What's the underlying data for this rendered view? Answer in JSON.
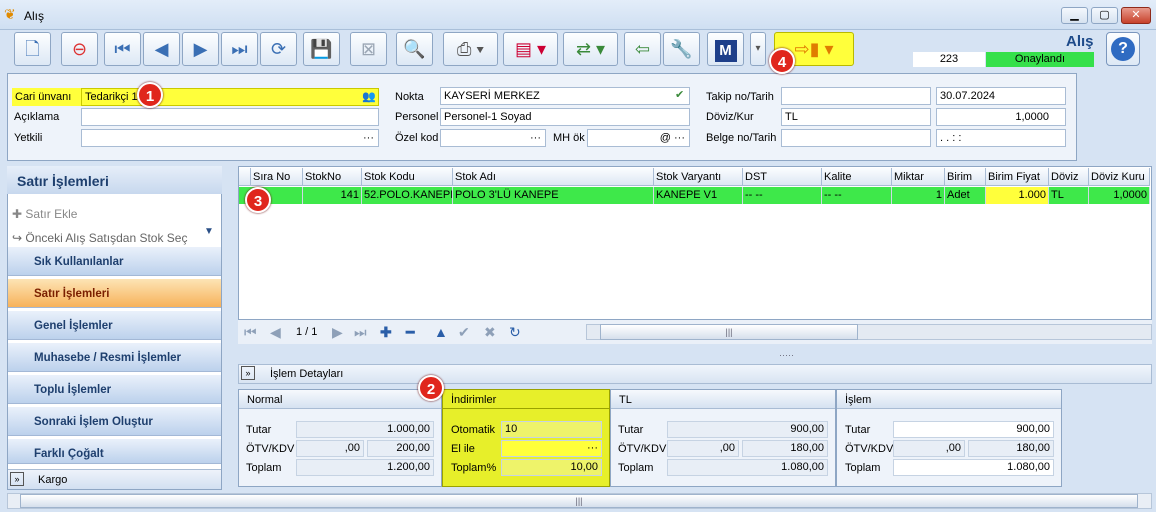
{
  "window": {
    "title": "Alış",
    "minimize": "▁",
    "maximize": "▢",
    "close": "✕"
  },
  "toolbar": {
    "page_title": "Alış",
    "counter": "223",
    "status": "Onaylandı",
    "m_label": "M",
    "help": "?"
  },
  "header": {
    "cari_label": "Cari ünvanı",
    "cari_value": "Tedarikçi 1",
    "aciklama_label": "Açıklama",
    "yetkili_label": "Yetkili",
    "nokta_label": "Nokta",
    "nokta_value": "KAYSERİ MERKEZ",
    "personel_label": "Personel",
    "personel_value": "Personel-1 Soyad",
    "ozel_label": "Özel kod",
    "mh_label": "MH ök",
    "takip_label": "Takip no/Tarih",
    "takip_date": "30.07.2024",
    "doviz_label": "Döviz/Kur",
    "doviz_value": "TL",
    "kur_value": "1,0000",
    "belge_label": "Belge no/Tarih",
    "belge_date": ". .   : :"
  },
  "left": {
    "title": "Satır İşlemleri",
    "satir_ekle": "Satır Ekle",
    "onceki": "Önceki Alış Satışdan Stok Seç",
    "items": [
      "Sık Kullanılanlar",
      "Satır İşlemleri",
      "Genel İşlemler",
      "Muhasebe / Resmi İşlemler",
      "Toplu İşlemler",
      "Sonraki İşlem Oluştur",
      "Farklı Çoğalt"
    ],
    "kargo": "Kargo"
  },
  "grid": {
    "headers": [
      "Sıra No",
      "StokNo",
      "Stok Kodu",
      "Stok Adı",
      "Stok Varyantı",
      "DST",
      "Kalite",
      "Miktar",
      "Birim",
      "Birim Fiyat",
      "Döviz",
      "Döviz Kuru"
    ],
    "row": [
      "1",
      "141",
      "52.POLO.KANEPE",
      "POLO 3'LÜ KANEPE",
      "KANEPE V1",
      "-- --",
      "-- --",
      "1",
      "Adet",
      "1.000",
      "TL",
      "1,0000"
    ],
    "page": "1 / 1"
  },
  "detail": {
    "title": "İşlem Detayları",
    "normal": {
      "title": "Normal",
      "tutar_label": "Tutar",
      "tutar": "1.000,00",
      "otv_label": "ÖTV/KDV",
      "otv": ",00",
      "kdv": "200,00",
      "toplam_label": "Toplam",
      "toplam": "1.200,00"
    },
    "indirim": {
      "title": "İndirimler",
      "oto_label": "Otomatik",
      "oto": "10",
      "elile_label": "El ile",
      "toplam_label": "Toplam%",
      "toplam": "10,00"
    },
    "tl": {
      "title": "TL",
      "tutar_label": "Tutar",
      "tutar": "900,00",
      "otv_label": "ÖTV/KDV",
      "otv": ",00",
      "kdv": "180,00",
      "toplam_label": "Toplam",
      "toplam": "1.080,00"
    },
    "islem": {
      "title": "İşlem",
      "tutar_label": "Tutar",
      "tutar": "900,00",
      "otv_label": "ÖTV/KDV",
      "otv": ",00",
      "kdv": "180,00",
      "toplam_label": "Toplam",
      "toplam": "1.080,00"
    }
  },
  "badges": [
    "1",
    "2",
    "3",
    "4"
  ]
}
